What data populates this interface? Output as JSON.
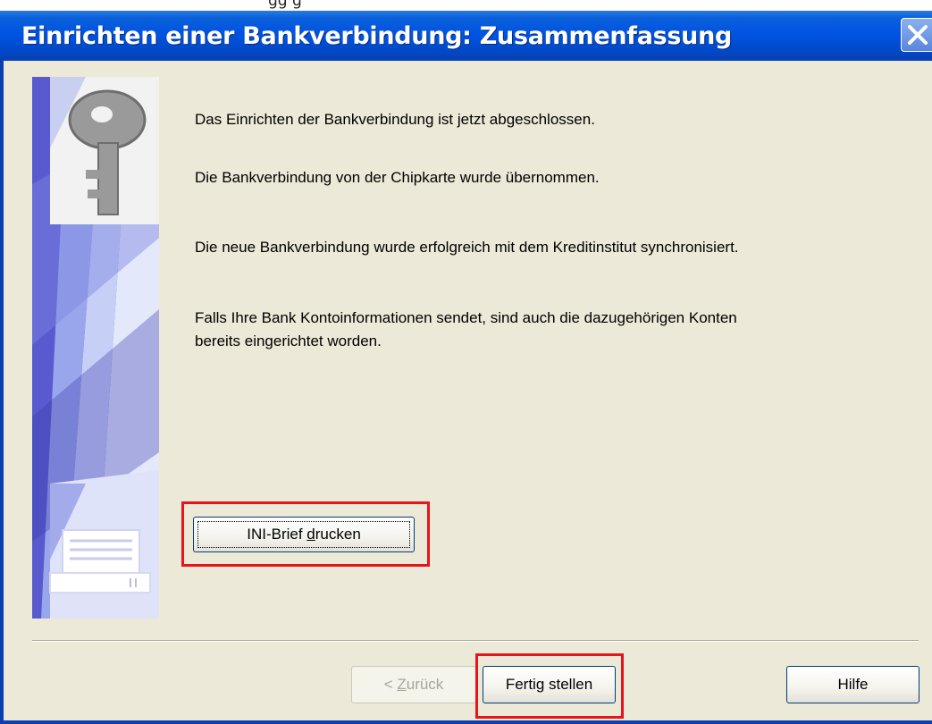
{
  "window": {
    "title": "Einrichten einer Bankverbindung: Zusammenfassung",
    "top_partial_text": "gg g"
  },
  "messages": [
    "Das Einrichten der Bankverbindung ist jetzt abgeschlossen.",
    "Die Bankverbindung von der Chipkarte wurde übernommen.",
    "Die neue Bankverbindung wurde erfolgreich mit dem Kreditinstitut synchronisiert.",
    "Falls Ihre Bank Kontoinformationen sendet, sind auch die dazugehörigen Konten",
    "bereits eingerichtet worden."
  ],
  "buttons": {
    "print_ini_prefix": "INI-Brief ",
    "print_ini_mnemonic": "d",
    "print_ini_suffix": "rucken",
    "back_prefix": "< ",
    "back_mnemonic": "Z",
    "back_suffix": "urück",
    "finish": "Fertig stellen",
    "help": "Hilfe"
  },
  "state": {
    "back_enabled": false,
    "highlighted": [
      "INI-Brief drucken",
      "Fertig stellen"
    ]
  },
  "colors": {
    "titlebar": "#0054e3",
    "dialog_bg": "#ece9d8",
    "highlight": "#e8131b"
  },
  "icons": [
    "close-icon",
    "key-icon",
    "card-reader-icon"
  ]
}
